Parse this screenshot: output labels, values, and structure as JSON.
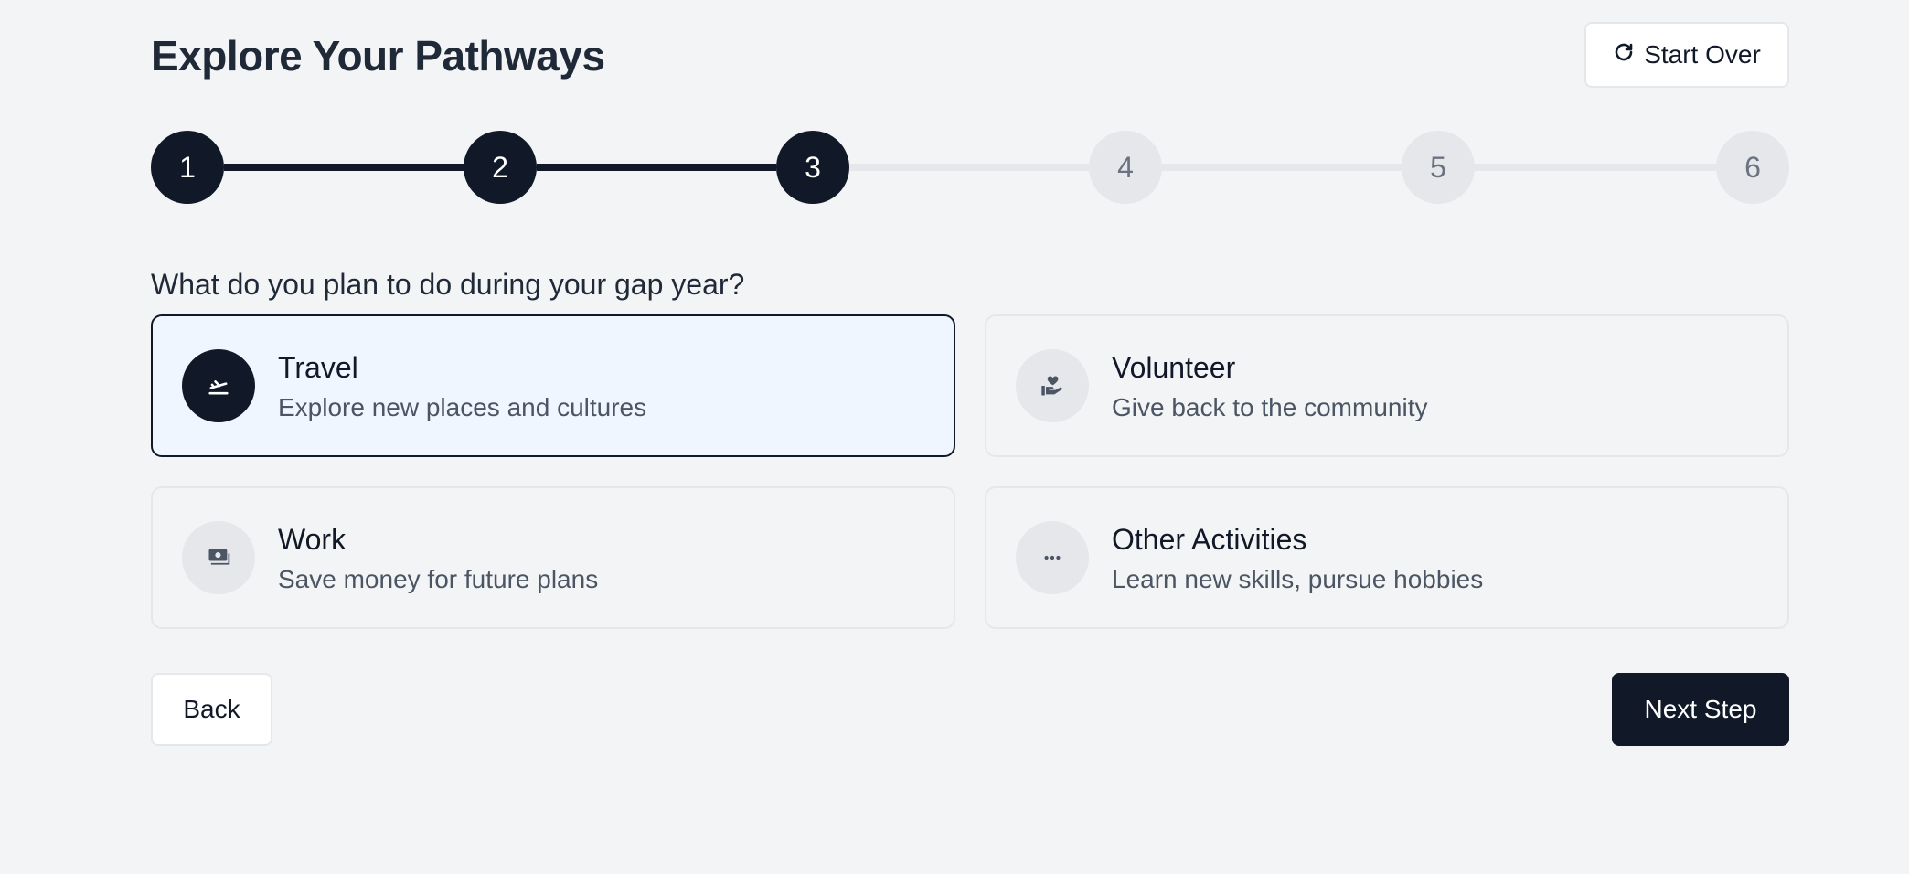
{
  "header": {
    "title": "Explore Your Pathways",
    "start_over_label": "Start Over",
    "start_over_icon": "refresh-icon"
  },
  "stepper": {
    "current_step": 3,
    "steps": [
      "1",
      "2",
      "3",
      "4",
      "5",
      "6"
    ]
  },
  "question": "What do you plan to do during your gap year?",
  "options": [
    {
      "title": "Travel",
      "description": "Explore new places and cultures",
      "icon": "plane-departure-icon",
      "selected": true
    },
    {
      "title": "Volunteer",
      "description": "Give back to the community",
      "icon": "hand-heart-icon",
      "selected": false
    },
    {
      "title": "Work",
      "description": "Save money for future plans",
      "icon": "money-icon",
      "selected": false
    },
    {
      "title": "Other Activities",
      "description": "Learn new skills, pursue hobbies",
      "icon": "ellipsis-icon",
      "selected": false
    }
  ],
  "footer": {
    "back_label": "Back",
    "next_label": "Next Step"
  },
  "colors": {
    "primary": "#111827",
    "background": "#f3f4f6",
    "selected_bg": "#eff6ff",
    "inactive": "#e5e7eb",
    "muted_text": "#4b5563"
  }
}
